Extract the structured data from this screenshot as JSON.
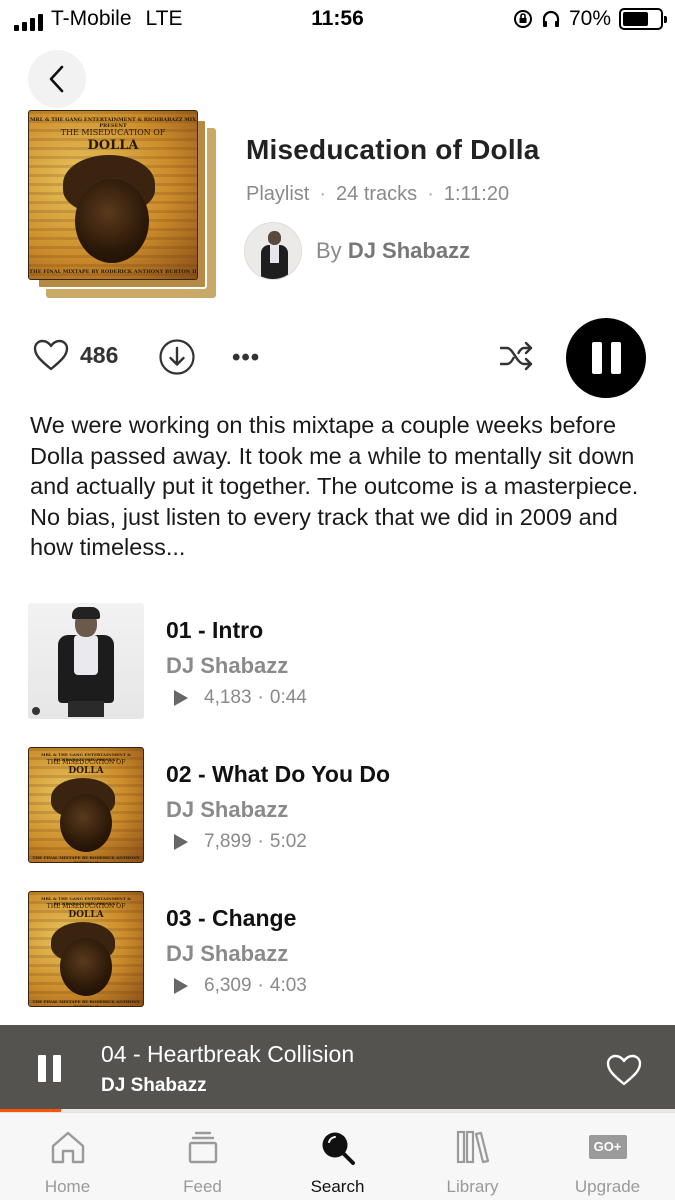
{
  "status_bar": {
    "carrier": "T-Mobile",
    "network": "LTE",
    "time": "11:56",
    "battery_percent": "70%",
    "battery_level": 0.7
  },
  "playlist": {
    "title": "Miseducation of Dolla",
    "type": "Playlist",
    "tracks_count": "24 tracks",
    "duration": "1:11:20",
    "by_label": "By",
    "creator": "DJ Shabazz",
    "cover": {
      "top_line": "MRL & THE GANG ENTERTAINMENT & RICHBABAZZ MIX PRESENT",
      "line1": "THE MISEDUCATION OF",
      "line2": "DOLLA",
      "bottom_line": "THE FINAL MIXTAPE BY RODERICK ANTHONY BURTON II"
    }
  },
  "actions": {
    "like_count": "486",
    "more_label": "•••"
  },
  "description": "We were working on this mixtape a couple weeks before Dolla passed away.  It took me a while to mentally sit down and actually put it together.  The outcome is a masterpiece. No bias, just listen to every track that we did in 2009 and how timeless...",
  "tracks": [
    {
      "title": "01 - Intro",
      "artist": "DJ Shabazz",
      "plays": "4,183",
      "duration": "0:44",
      "thumb": "photo"
    },
    {
      "title": "02 - What Do You Do",
      "artist": "DJ Shabazz",
      "plays": "7,899",
      "duration": "5:02",
      "thumb": "cover"
    },
    {
      "title": "03 - Change",
      "artist": "DJ Shabazz",
      "plays": "6,309",
      "duration": "4:03",
      "thumb": "cover"
    }
  ],
  "now_playing": {
    "title": "04 - Heartbreak Collision",
    "artist": "DJ Shabazz",
    "progress": 0.09
  },
  "tabs": [
    {
      "label": "Home",
      "icon": "home-icon",
      "active": false
    },
    {
      "label": "Feed",
      "icon": "feed-icon",
      "active": false
    },
    {
      "label": "Search",
      "icon": "search-icon",
      "active": true
    },
    {
      "label": "Library",
      "icon": "library-icon",
      "active": false
    },
    {
      "label": "Upgrade",
      "icon": "go-plus-icon",
      "active": false
    }
  ],
  "upgrade_badge": "GO+",
  "colors": {
    "accent": "#ff5500",
    "mini_player_bg": "#545350",
    "muted_text": "#8a8a8a"
  }
}
